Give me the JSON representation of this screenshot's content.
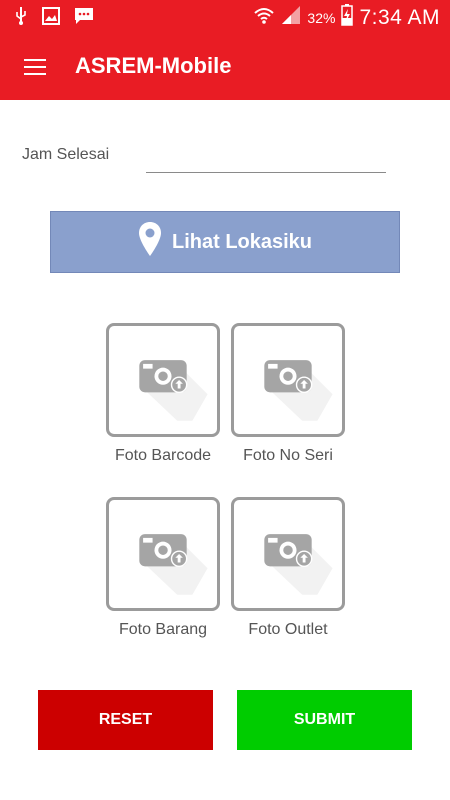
{
  "status_bar": {
    "battery_percent": "32%",
    "time": "7:34 AM",
    "icons": [
      "usb-icon",
      "image-icon",
      "chat-icon",
      "wifi-icon",
      "signal-icon",
      "battery-charging-icon"
    ]
  },
  "app_bar": {
    "title": "ASREM-Mobile",
    "menu_icon": "menu-icon"
  },
  "form": {
    "end_time_label": "Jam Selesai",
    "end_time_value": ""
  },
  "location_button": {
    "label": "Lihat Lokasiku",
    "icon": "location-pin-icon"
  },
  "photos": [
    {
      "label": "Foto Barcode",
      "icon": "camera-upload-icon"
    },
    {
      "label": "Foto No Seri",
      "icon": "camera-upload-icon"
    },
    {
      "label": "Foto Barang",
      "icon": "camera-upload-icon"
    },
    {
      "label": "Foto Outlet",
      "icon": "camera-upload-icon"
    }
  ],
  "actions": {
    "reset_label": "RESET",
    "submit_label": "SUBMIT"
  },
  "colors": {
    "primary": "#e91c24",
    "location_button": "#8aa0cd",
    "reset": "#cc0000",
    "submit": "#00cc00"
  }
}
